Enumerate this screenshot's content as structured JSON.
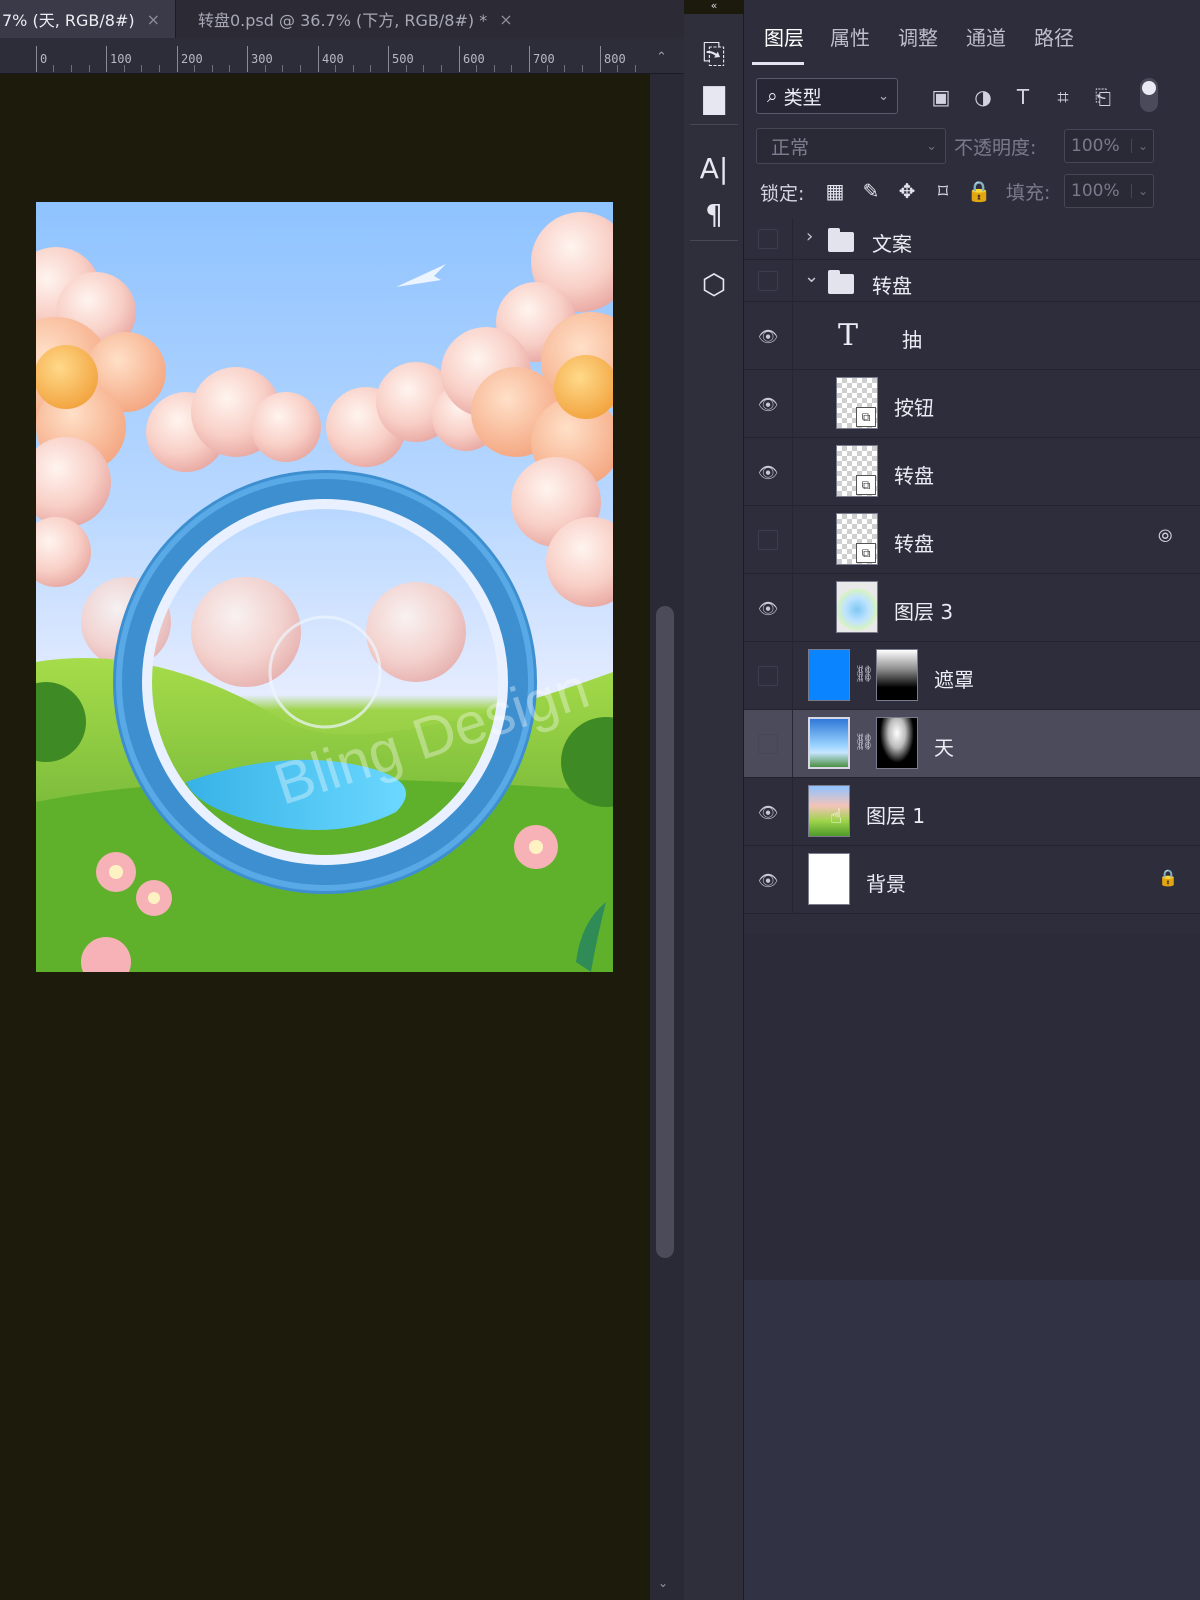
{
  "tabs": [
    {
      "label": "7% (天, RGB/8#)",
      "close": "×",
      "active": true
    },
    {
      "label": "转盘0.psd @ 36.7% (下方, RGB/8#) *",
      "close": "×",
      "active": false
    }
  ],
  "ruler": {
    "labels": [
      "0",
      "100",
      "200",
      "300",
      "400",
      "500",
      "600",
      "700",
      "800"
    ],
    "up_glyph": "⌃"
  },
  "collapse_glyph": "«",
  "canvas": {
    "watermark": "Bling Design"
  },
  "toolstrip": {
    "icons": [
      "history-icon",
      "comment-icon",
      "character-icon",
      "paragraph-icon",
      "3d-cube-icon"
    ],
    "glyphs": [
      "⎘",
      "▇",
      "A|",
      "¶",
      "⬡"
    ]
  },
  "panel": {
    "tabs": [
      "图层",
      "属性",
      "调整",
      "通道",
      "路径"
    ],
    "active_tab": 0,
    "filter": {
      "label": "类型",
      "glyph": "⌕",
      "chevron": "⌄",
      "icon_glyphs": [
        "▣",
        "◑",
        "T",
        "⌗",
        "⎗"
      ]
    },
    "blend": {
      "mode": "正常",
      "opacity_label": "不透明度:",
      "opacity": "100%",
      "fill_label": "填充:",
      "fill": "100%",
      "chevron": "⌄"
    },
    "lock": {
      "label": "锁定:",
      "glyphs": [
        "▦",
        "✎",
        "✥",
        "⌑",
        "🔒"
      ]
    },
    "layers": [
      {
        "name": "文案",
        "type": "group",
        "expanded": false,
        "visible": false
      },
      {
        "name": "转盘",
        "type": "group",
        "expanded": true,
        "visible": false
      },
      {
        "name": "抽",
        "type": "text",
        "visible": true
      },
      {
        "name": "按钮",
        "type": "smart",
        "visible": true
      },
      {
        "name": "转盘",
        "type": "smart",
        "visible": true
      },
      {
        "name": "转盘",
        "type": "smart",
        "visible": false,
        "right_glyph": "⦾"
      },
      {
        "name": "图层 3",
        "type": "image",
        "visible": true
      },
      {
        "name": "遮罩",
        "type": "masked-fill",
        "visible": false
      },
      {
        "name": "天",
        "type": "masked-image",
        "visible": false,
        "selected": true
      },
      {
        "name": "图层 1",
        "type": "image",
        "visible": true
      },
      {
        "name": "背景",
        "type": "background",
        "visible": true,
        "lock_glyph": "🔒"
      }
    ],
    "glyphs": {
      "eye": "👁",
      "chain": "⛓",
      "type_t": "T",
      "smart": "⧉",
      "collapsed": "›",
      "expanded": "⌄"
    }
  },
  "colors": {
    "accent": "#0a84ff",
    "panel": "#2d2d3b",
    "canvas_bg": "#1d1c0c",
    "selected": "#4b4b5c"
  }
}
